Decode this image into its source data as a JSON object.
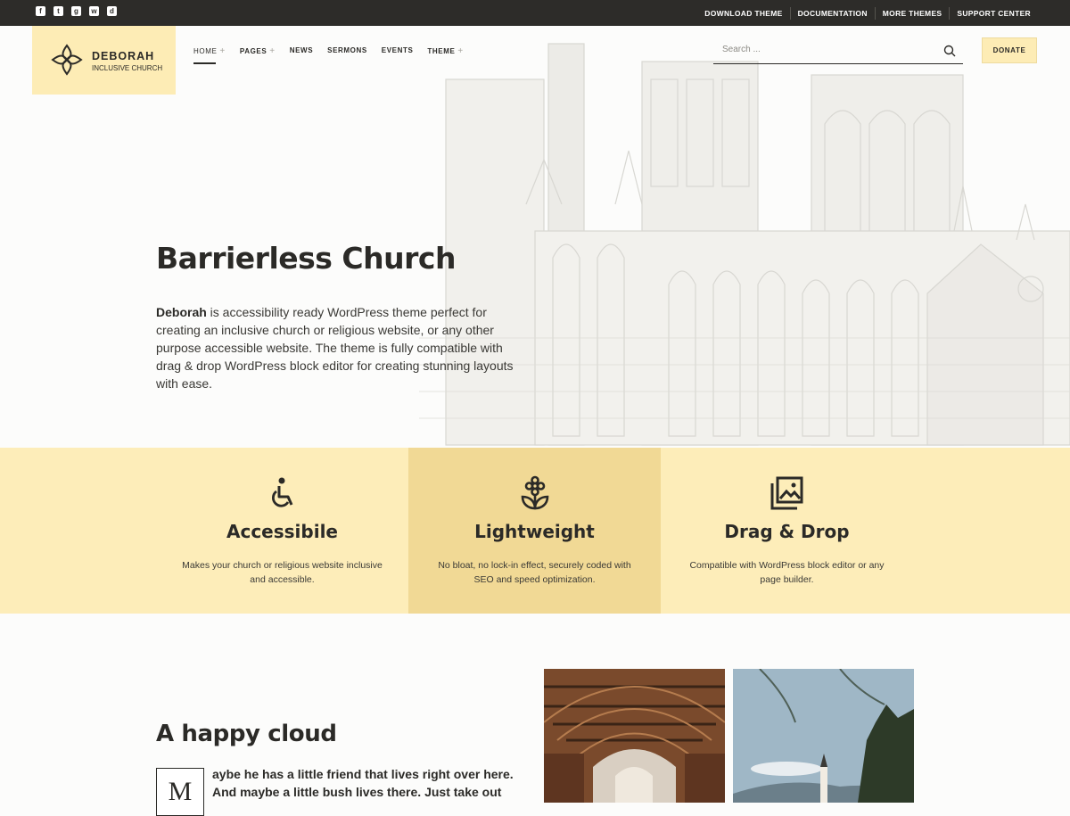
{
  "topbar": {
    "social": [
      {
        "icon": "facebook-icon",
        "glyph": "f"
      },
      {
        "icon": "twitter-icon",
        "glyph": "t"
      },
      {
        "icon": "github-icon",
        "glyph": "g"
      },
      {
        "icon": "wordpress-icon",
        "glyph": "w"
      },
      {
        "icon": "dribbble-icon",
        "glyph": "d"
      }
    ],
    "links": [
      "DOWNLOAD THEME",
      "DOCUMENTATION",
      "MORE THEMES",
      "SUPPORT CENTER"
    ]
  },
  "header": {
    "logo_title": "DEBORAH",
    "logo_subtitle": "INCLUSIVE CHURCH",
    "nav": {
      "home": "HOME",
      "pages": "PAGES",
      "news": "NEWS",
      "sermons": "SERMONS",
      "events": "EVENTS",
      "theme": "THEME",
      "plus": "+"
    },
    "search_placeholder": "Search ...",
    "donate": "DONATE"
  },
  "hero": {
    "title": "Barrierless Church",
    "text_strong": "Deborah",
    "text_rest": " is accessibility ready WordPress theme perfect for creating an inclusive church or religious website, or any other purpose accessible website. The theme is fully compatible with drag & drop WordPress block editor for creating stunning layouts with ease."
  },
  "features": [
    {
      "icon": "wheelchair-icon",
      "title": "Accessibile",
      "text": "Makes your church or religious website inclusive and accessible."
    },
    {
      "icon": "flower-icon",
      "title": "Lightweight",
      "text": "No bloat, no lock-in effect, securely coded with SEO and speed optimization."
    },
    {
      "icon": "gallery-icon",
      "title": "Drag & Drop",
      "text": "Compatible with WordPress block editor or any page builder."
    }
  ],
  "lower": {
    "title": "A happy cloud",
    "dropcap": "M",
    "text": "aybe he has a little friend that lives right over here. And maybe a little bush lives there. Just take out"
  },
  "colors": {
    "topbar": "#2d2c29",
    "accent_light": "#fdecb5",
    "accent_mid": "#f1d995",
    "text": "#2b2a27"
  }
}
